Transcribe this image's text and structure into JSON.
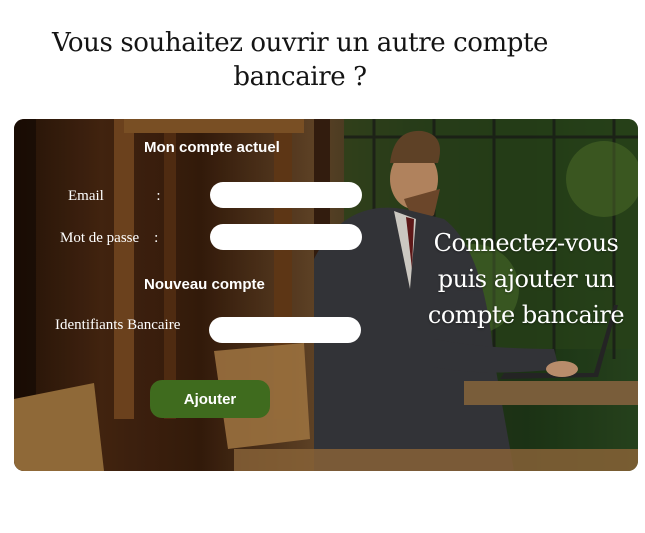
{
  "page": {
    "title": "Vous souhaitez ouvrir un autre compte bancaire ?"
  },
  "form": {
    "current_section_title": "Mon compte actuel",
    "email_label": "Email              :",
    "email_value": "",
    "password_label": "Mot de passe    :",
    "password_value": "",
    "new_section_title": "Nouveau compte",
    "bank_ids_label": "Identifiants Bancaire",
    "bank_ids_value": "",
    "submit_label": "Ajouter"
  },
  "hero": {
    "cta_text": "Connectez-vous puis ajouter un compte bancaire",
    "image_description_icon": "man-with-laptop-photo"
  },
  "colors": {
    "button": "#3f6b1e",
    "text_on_image": "#ffffff"
  }
}
